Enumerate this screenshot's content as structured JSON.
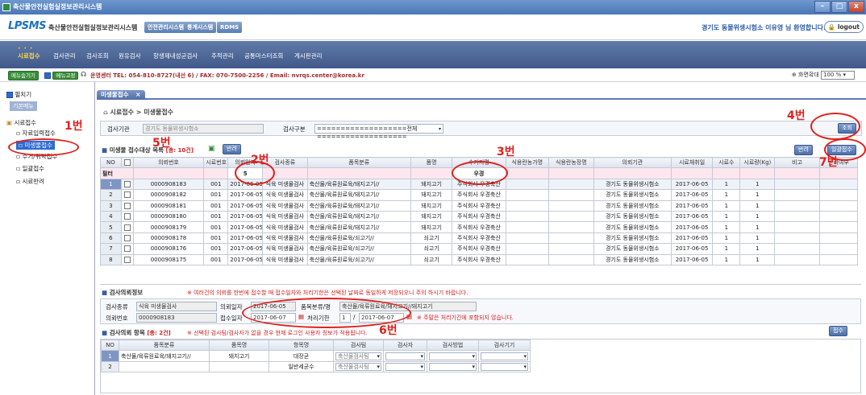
{
  "window": {
    "title": "축산물안전실험실정보관리시스템"
  },
  "header": {
    "logo": "LPSMS",
    "system_name": "축산물안전실험실정보관리시스템",
    "buttons": [
      "안전관리시스템",
      "통계시스템",
      "RDMS"
    ],
    "welcome": "경기도 동물위생시험소 이유영 님 환영합니다.",
    "logout": "logout"
  },
  "menu": [
    "시료접수",
    "검사관리",
    "검사조회",
    "원유검사",
    "항생제내성균검사",
    "추적관리",
    "공통마스터조회",
    "게시판관리"
  ],
  "toolbar": {
    "menu_hide": "메뉴숨기기",
    "menu_fix": "메뉴고정",
    "notice": "운영센터 TEL: 054-810-8727(내선 6) / FAX: 070-7500-2256 / Email: nvrqs.center@korea.kr",
    "zoom_label": "화면확대",
    "zoom_value": "100 %"
  },
  "sidebar": {
    "expand": "펼치기",
    "basic_menu": "기본메뉴",
    "root": "시료접수",
    "items": [
      "자료입력접수",
      "미생물접수",
      "수거/위탁접수",
      "일괄접수",
      "시료반려"
    ]
  },
  "tab": {
    "label": "미생물접수"
  },
  "breadcrumb": {
    "path": "시료접수 > 미생물접수"
  },
  "search": {
    "agency_label": "검사기관",
    "agency_value": "경기도 동물위생시험소",
    "type_label": "검사구분",
    "type_value": "===================전체===================",
    "search_btn": "조회"
  },
  "list": {
    "title": "미생물 접수대상 목록",
    "count": "[총: 10건]",
    "return_btn": "반려",
    "return_btn2": "반려",
    "batch_btn": "일괄접수",
    "headers": [
      "NO",
      "",
      "의뢰번호",
      "시료번호",
      "의뢰일자",
      "검사종류",
      "품목분류",
      "품명",
      "수거지명",
      "식용란농가명",
      "식용란농장명",
      "의뢰기관",
      "시료채취일",
      "시료수",
      "시료량(Kg)",
      "비고",
      "반려여부"
    ],
    "filter_label": "필터",
    "filter_no": "5",
    "filter_site": "우경",
    "rows": [
      [
        "1",
        "",
        "0000908183",
        "001",
        "2017-06-05",
        "식육 미생물검사",
        "축산물/육류원료육/돼지고기//",
        "돼지고기",
        "주식회사 우경축산",
        "",
        "",
        "경기도 동물위생시험소",
        "2017-06-05",
        "1",
        "1",
        ""
      ],
      [
        "2",
        "",
        "0000908182",
        "001",
        "2017-06-05",
        "식육 미생물검사",
        "축산물/육류원료육/돼지고기//",
        "돼지고기",
        "주식회사 우경축산",
        "",
        "",
        "경기도 동물위생시험소",
        "2017-06-05",
        "1",
        "1",
        ""
      ],
      [
        "3",
        "",
        "0000908181",
        "001",
        "2017-06-05",
        "식육 미생물검사",
        "축산물/육류원료육/돼지고기//",
        "돼지고기",
        "주식회사 우경축산",
        "",
        "",
        "경기도 동물위생시험소",
        "2017-06-05",
        "1",
        "1",
        ""
      ],
      [
        "4",
        "",
        "0000908180",
        "001",
        "2017-06-05",
        "식육 미생물검사",
        "축산물/육류원료육/돼지고기//",
        "돼지고기",
        "주식회사 우경축산",
        "",
        "",
        "경기도 동물위생시험소",
        "2017-06-05",
        "1",
        "1",
        ""
      ],
      [
        "5",
        "",
        "0000908179",
        "001",
        "2017-06-05",
        "식육 미생물검사",
        "축산물/육류원료육/돼지고기//",
        "돼지고기",
        "주식회사 우경축산",
        "",
        "",
        "경기도 동물위생시험소",
        "2017-06-05",
        "1",
        "1",
        ""
      ],
      [
        "6",
        "",
        "0000908178",
        "001",
        "2017-06-05",
        "식육 미생물검사",
        "축산물/육류원료육/쇠고기//",
        "쇠고기",
        "주식회사 우경축산",
        "",
        "",
        "경기도 동물위생시험소",
        "2017-06-05",
        "1",
        "1",
        ""
      ],
      [
        "7",
        "",
        "0000908176",
        "001",
        "2017-06-05",
        "식육 미생물검사",
        "축산물/육류원료육/쇠고기//",
        "쇠고기",
        "주식회사 우경축산",
        "",
        "",
        "경기도 동물위생시험소",
        "2017-06-05",
        "1",
        "1",
        ""
      ],
      [
        "8",
        "",
        "0000908175",
        "001",
        "2017-06-05",
        "식육 미생물검사",
        "축산물/육류원료육/쇠고기//",
        "쇠고기",
        "주식회사 우경축산",
        "",
        "",
        "경기도 동물위생시험소",
        "2017-06-05",
        "1",
        "1",
        ""
      ]
    ]
  },
  "info": {
    "title": "검사의뢰정보",
    "warning": "※ 여러건의 의뢰를 한번에 접수할 때 접수일자와 처리기한은 선택된 날짜로 동일하게 저장되오니 주의 하시기 바랍니다.",
    "type_label": "검사종류",
    "type_value": "식육 미생물검사",
    "reqno_label": "의뢰번호",
    "reqno_value": "0000908183",
    "reqdate_label": "의뢰일자",
    "reqdate_value": "2017-06-05",
    "recvdate_label": "접수일자",
    "recvdate_value": "2017-06-07",
    "cat_label": "품목분류/명",
    "cat_value": "축산물/육류원료육/돼지고기//돼지고기",
    "due_label": "처리기한",
    "due_value1": "1",
    "due_sep": "/",
    "due_value2": "2017-06-07",
    "due_note": "※ 주말은 처리기간에 포함되지 않습니다."
  },
  "items": {
    "title": "검사의뢰 항목",
    "count": "[총: 2건]",
    "warning": "※ 선택된 검사팀/검사자가 없을 경우 현재 로그인 사용자 정보가 적용됩니다.",
    "receive_btn": "접수",
    "headers": [
      "NO",
      "품목분류",
      "품목명",
      "항목명",
      "검사팀",
      "검사자",
      "검사방법",
      "검사기기"
    ],
    "rows": [
      [
        "1",
        "축산물/육류원료육/돼지고기//",
        "돼지고기",
        "대장균",
        "축산물검사팀",
        "",
        "",
        ""
      ],
      [
        "2",
        "",
        "",
        "일반세균수",
        "축산물검사팀",
        "",
        "",
        ""
      ]
    ]
  },
  "annotations": [
    "1번",
    "2번",
    "3번",
    "4번",
    "5번",
    "6번",
    "7번"
  ]
}
